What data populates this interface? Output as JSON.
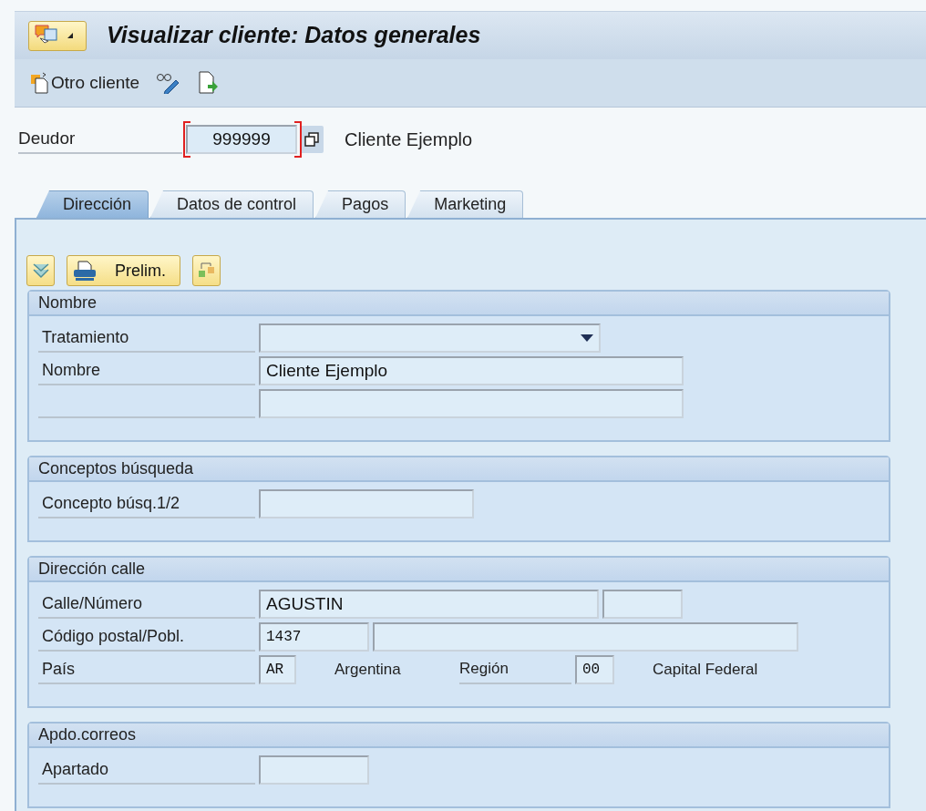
{
  "title": "Visualizar cliente: Datos generales",
  "toolbar": [
    {
      "kind": "labeled",
      "label": "Otro cliente"
    },
    {
      "kind": "glasses"
    },
    {
      "kind": "export"
    }
  ],
  "header": {
    "label": "Deudor",
    "value": "999999",
    "description": "Cliente Ejemplo"
  },
  "tabs": [
    {
      "label": "Dirección",
      "selected": true
    },
    {
      "label": "Datos de control",
      "selected": false
    },
    {
      "label": "Pagos",
      "selected": false
    },
    {
      "label": "Marketing",
      "selected": false
    }
  ],
  "panel_buttons": [
    {
      "kind": "expand"
    },
    {
      "kind": "print",
      "label": "Prelim."
    },
    {
      "kind": "switch"
    }
  ],
  "groups": [
    {
      "title": "Nombre",
      "rows": [
        {
          "label": "Tratamiento",
          "items": [
            {
              "kind": "dropdown"
            }
          ]
        },
        {
          "label": "Nombre",
          "items": [
            {
              "kind": "field",
              "value": "Cliente Ejemplo"
            }
          ]
        },
        {
          "items": [
            {
              "kind": "field"
            }
          ]
        }
      ]
    },
    {
      "title": "Conceptos búsqueda",
      "rows": [
        {
          "label": "Concepto búsq.1/2",
          "items": [
            {
              "kind": "field"
            }
          ]
        }
      ]
    },
    {
      "title": "Dirección calle",
      "rows": [
        {
          "label": "Calle/Número",
          "items": [
            {
              "kind": "field",
              "value": "AGUSTIN"
            },
            {
              "kind": "field"
            }
          ]
        },
        {
          "label": "Código postal/Pobl.",
          "items": [
            {
              "kind": "mono",
              "value": "1437"
            },
            {
              "kind": "field"
            }
          ]
        },
        {
          "label": "País",
          "items": [
            {
              "kind": "mono",
              "value": "AR"
            },
            {
              "kind": "text",
              "value": "Argentina"
            },
            {
              "kind": "label",
              "value": "Región"
            },
            {
              "kind": "mono",
              "value": "00"
            },
            {
              "kind": "text",
              "value": "Capital Federal"
            }
          ]
        }
      ]
    },
    {
      "title": "Apdo.correos",
      "rows": [
        {
          "label": "Apartado",
          "items": [
            {
              "kind": "field"
            }
          ]
        }
      ]
    }
  ]
}
